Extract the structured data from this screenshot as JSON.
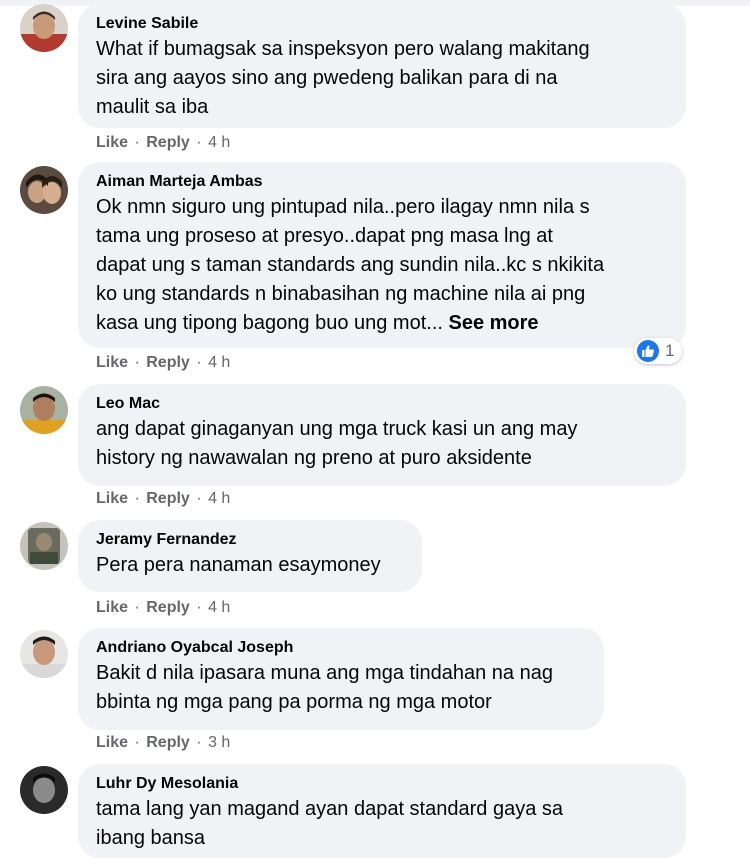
{
  "colors": {
    "bubble": "#f0f2f5",
    "meta_text": "#65676b",
    "like_blue": "#1877f2"
  },
  "actions": {
    "like": "Like",
    "reply": "Reply",
    "separator": "·"
  },
  "comments": [
    {
      "author": "Levine Sabile",
      "text": "What if bumagsak sa inspeksyon pero walang makitang\nsira ang aayos sino ang pwedeng balikan para di na\nmaulit sa iba",
      "time": "4 h"
    },
    {
      "author": "Aiman Marteja Ambas",
      "text": "Ok nmn siguro ung pintupad nila..pero ilagay nmn nila s\ntama ung proseso at presyo..dapat png masa lng at\ndapat ung s taman standards ang sundin nila..kc s nkikita\nko ung standards n binabasihan ng machine nila ai png\nkasa ung tipong bagong buo ung mot... ",
      "see_more": "See more",
      "time": "4 h",
      "reaction_icon": "like-icon",
      "reaction_count": "1"
    },
    {
      "author": "Leo Mac",
      "text": "ang dapat ginaganyan ung mga truck kasi un ang may\nhistory ng nawawalan ng preno at puro aksidente",
      "time": "4 h"
    },
    {
      "author": "Jeramy Fernandez",
      "text": "Pera pera nanaman esaymoney",
      "time": "4 h"
    },
    {
      "author": "Andriano Oyabcal Joseph",
      "text": "Bakit d nila ipasara muna ang mga tindahan na nag\nbbinta ng mga pang pa porma ng mga motor",
      "time": "3 h"
    },
    {
      "author": "Luhr Dy Mesolania",
      "text": "tama lang yan magand ayan dapat standard gaya sa\nibang bansa",
      "time": ""
    }
  ]
}
